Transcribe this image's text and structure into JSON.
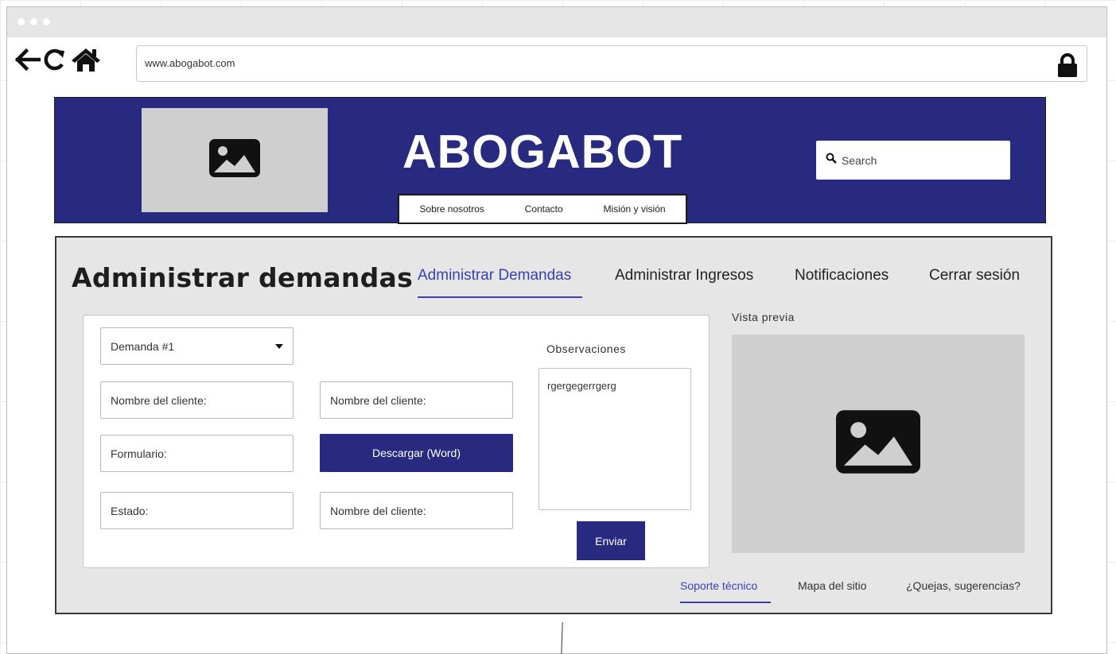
{
  "browser": {
    "url": "www.abogabot.com",
    "icons": [
      "back-arrow-icon",
      "reload-icon",
      "home-icon",
      "lock-icon"
    ]
  },
  "header": {
    "brand": "ABOGABOT",
    "logo_icon": "image-placeholder-icon",
    "nav": [
      "Sobre nosotros",
      "Contacto",
      "Misión y visión"
    ],
    "search_placeholder": "Search",
    "bg_color": "#272a7e"
  },
  "main": {
    "title": "Administrar demandas",
    "tabs": [
      {
        "label": "Administrar Demandas",
        "active": true
      },
      {
        "label": "Administrar Ingresos",
        "active": false
      },
      {
        "label": "Notificaciones",
        "active": false
      },
      {
        "label": "Cerrar sesión",
        "active": false
      }
    ],
    "form": {
      "demand_select": "Demanda #1",
      "client_name_1": "Nombre del cliente:",
      "client_name_2": "Nombre del cliente:",
      "form_field": "Formulario:",
      "download_button": "Descargar (Word)",
      "status_field": "Estado:",
      "client_name_3": "Nombre del cliente:",
      "observations_label": "Observaciones",
      "observations_value": "rgergegerrgerg",
      "send_button": "Enviar"
    },
    "preview": {
      "label": "Vista previa",
      "icon": "image-placeholder-icon"
    },
    "footer_links": [
      {
        "label": "Soporte técnico",
        "active": true
      },
      {
        "label": "Mapa del sitio",
        "active": false
      },
      {
        "label": "¿Quejas, sugerencias?",
        "active": false
      }
    ],
    "accent_color": "#3b3fb5"
  }
}
